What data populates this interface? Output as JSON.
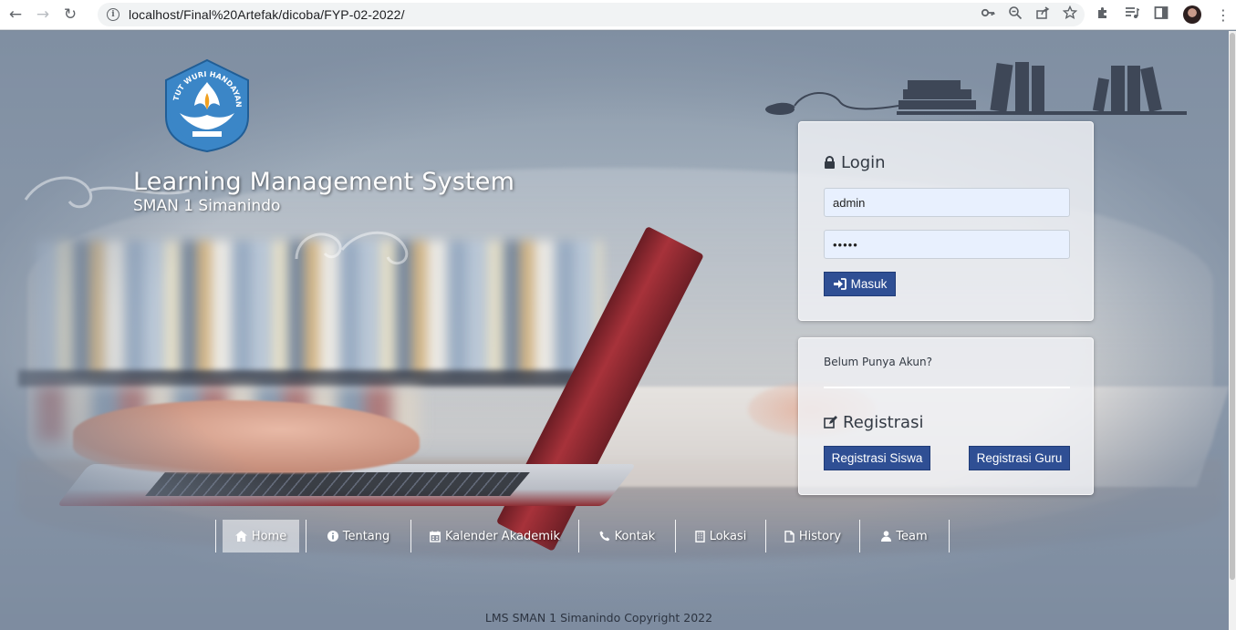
{
  "browser": {
    "url": "localhost/Final%20Artefak/dicoba/FYP-02-2022/",
    "icons": {
      "back": "arrow-left-icon",
      "forward": "arrow-right-icon",
      "reload": "reload-icon",
      "info": "info-icon",
      "key": "key-icon",
      "zoom": "zoom-icon",
      "share": "share-icon",
      "bookmark": "star-icon",
      "extensions": "puzzle-icon",
      "media": "playlist-icon",
      "sidepanel": "side-panel-icon",
      "menu": "kebab-menu-icon"
    }
  },
  "header": {
    "logo_text": "TUT WURI HANDAYANI",
    "title": "Learning Management System",
    "subtitle": "SMAN 1 Simanindo"
  },
  "login": {
    "heading": "Login",
    "username_value": "admin",
    "password_value": "•••••",
    "submit_label": "Masuk"
  },
  "registration": {
    "question": "Belum Punya Akun?",
    "heading": "Registrasi",
    "student_button": "Registrasi Siswa",
    "teacher_button": "Registrasi Guru"
  },
  "menu": {
    "items": [
      {
        "label": "Home",
        "icon": "home-icon"
      },
      {
        "label": "Tentang",
        "icon": "info-icon"
      },
      {
        "label": "Kalender Akademik",
        "icon": "calendar-icon"
      },
      {
        "label": "Kontak",
        "icon": "phone-icon"
      },
      {
        "label": "Lokasi",
        "icon": "building-icon"
      },
      {
        "label": "History",
        "icon": "file-icon"
      },
      {
        "label": "Team",
        "icon": "user-icon"
      }
    ],
    "active": "Home"
  },
  "footer": {
    "text": "LMS SMAN 1 Simanindo Copyright 2022"
  },
  "colors": {
    "button": "#2f4f94",
    "input_bg": "#e8f0fe"
  }
}
